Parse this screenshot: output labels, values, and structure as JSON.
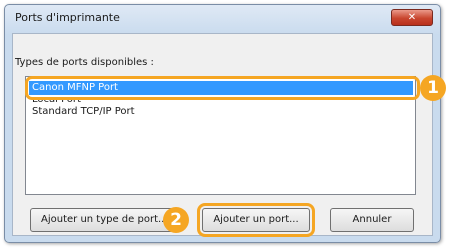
{
  "window": {
    "title": "Ports d'imprimante",
    "close_glyph": "✕"
  },
  "section": {
    "label": "Types de ports disponibles :"
  },
  "ports": [
    {
      "label": "Canon MFNP Port",
      "selected": true
    },
    {
      "label": "Local Port",
      "selected": false
    },
    {
      "label": "Standard TCP/IP Port",
      "selected": false
    }
  ],
  "buttons": {
    "add_port_type": "Ajouter un type de port...",
    "add_port": "Ajouter un port...",
    "cancel": "Annuler"
  },
  "callouts": {
    "one": "1",
    "two": "2"
  },
  "colors": {
    "selection": "#3399ff",
    "callout": "#f5a623",
    "close_button": "#c9462f"
  }
}
